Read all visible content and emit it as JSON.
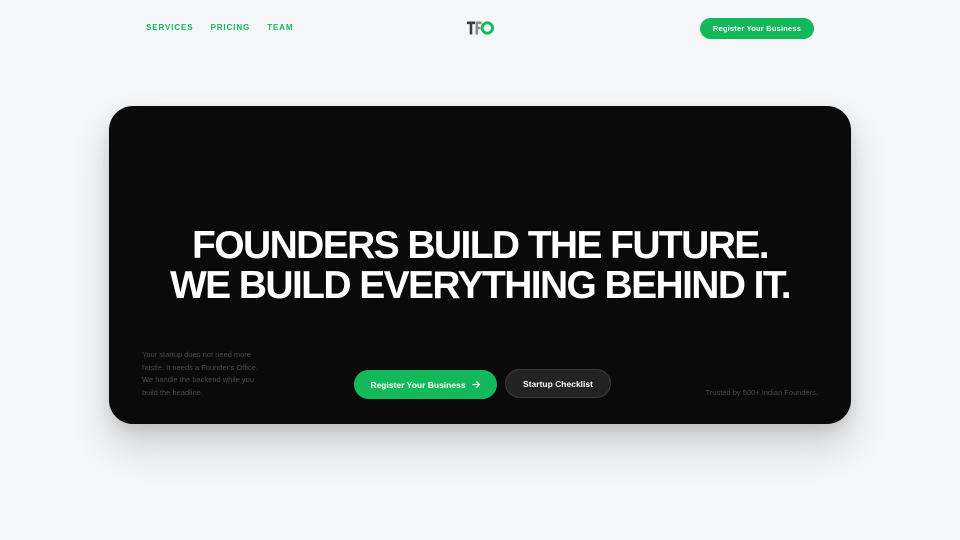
{
  "header": {
    "nav": [
      {
        "label": "SERVICES"
      },
      {
        "label": "PRICING"
      },
      {
        "label": "TEAM"
      }
    ],
    "logo_text": "TFO",
    "cta_label": "Register Your Business"
  },
  "hero": {
    "headline_line1": "FOUNDERS BUILD THE FUTURE.",
    "headline_line2": "WE BUILD EVERYTHING BEHIND IT.",
    "intro": "Your startup does not need more hustle. It needs a Founder's Office. We handle the backend while you build the headline.",
    "primary_button": "Register Your Business",
    "secondary_button": "Startup Checklist",
    "trusted_text": "Trusted by 500+ Indian Founders."
  },
  "colors": {
    "accent": "#12b85a",
    "card_bg": "#0a0a0a",
    "page_bg": "#f4f6f8"
  },
  "icons": {
    "logo": "tfo-logo-icon",
    "arrow": "arrow-right-icon"
  }
}
